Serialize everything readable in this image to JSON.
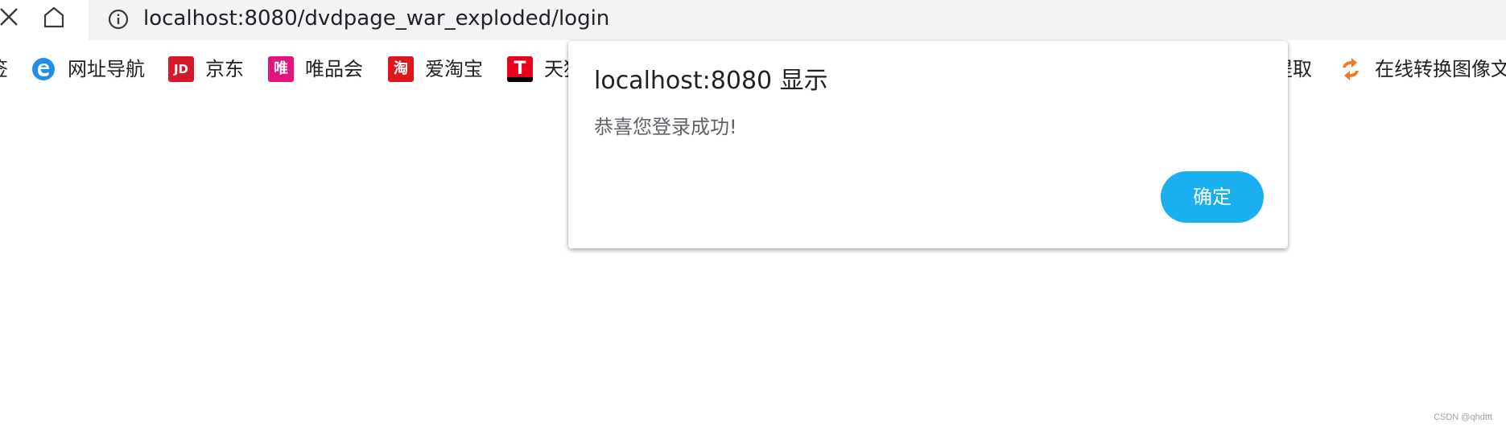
{
  "browser": {
    "url": "localhost:8080/dvdpage_war_exploded/login"
  },
  "bookmarks": [
    {
      "label": "签",
      "icon": "bookmark-icon"
    },
    {
      "label": "网址导航",
      "icon": "edge-e-icon",
      "color": "#1e90e6"
    },
    {
      "label": "京东",
      "icon": "jd-icon",
      "color": "#d7182a",
      "icon_text": "JD"
    },
    {
      "label": "唯品会",
      "icon": "vip-icon",
      "color": "#e4147e",
      "icon_text": "唯"
    },
    {
      "label": "爱淘宝",
      "icon": "taobao-icon",
      "color": "#e0161d",
      "icon_text": "淘"
    },
    {
      "label": "天猫",
      "icon": "tmall-icon",
      "color": "#e8001c",
      "icon_text": "T"
    },
    {
      "label": "提取",
      "icon": "bookmark-icon"
    },
    {
      "label": "在线转换图像文",
      "icon": "convert-icon",
      "color": "#f07a2a"
    }
  ],
  "dialog": {
    "title": "localhost:8080 显示",
    "message": "恭喜您登录成功!",
    "ok_label": "确定",
    "accent": "#1ab0f0"
  },
  "watermark": "CSDN @qhdttt"
}
